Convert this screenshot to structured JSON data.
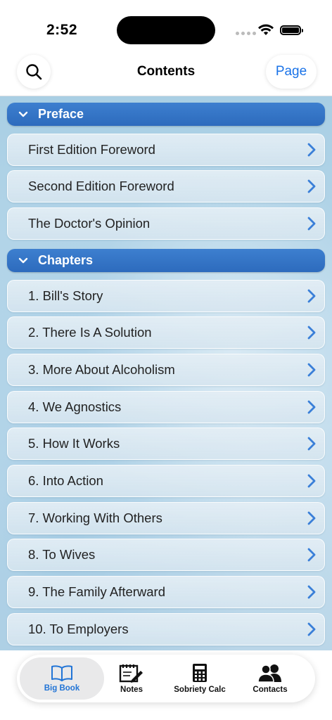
{
  "status": {
    "time": "2:52"
  },
  "nav": {
    "title": "Contents",
    "page_button": "Page"
  },
  "sections": [
    {
      "title": "Preface",
      "items": [
        "First Edition Foreword",
        "Second Edition Foreword",
        "The Doctor's Opinion"
      ]
    },
    {
      "title": "Chapters",
      "items": [
        "1. Bill's Story",
        "2. There Is A Solution",
        "3. More About Alcoholism",
        "4. We Agnostics",
        "5. How It Works",
        "6. Into Action",
        "7. Working With Others",
        "8. To Wives",
        "9. The Family Afterward",
        "10. To Employers"
      ]
    }
  ],
  "tabs": [
    {
      "label": "Big Book",
      "icon": "book-icon",
      "active": true
    },
    {
      "label": "Notes",
      "icon": "notes-icon",
      "active": false
    },
    {
      "label": "Sobriety Calc",
      "icon": "calculator-icon",
      "active": false
    },
    {
      "label": "Contacts",
      "icon": "contacts-icon",
      "active": false
    }
  ],
  "colors": {
    "accent": "#1a73e8",
    "section_header": "#2d6bbd",
    "chevron": "#3a7fd8",
    "tab_active": "#2174d6"
  }
}
